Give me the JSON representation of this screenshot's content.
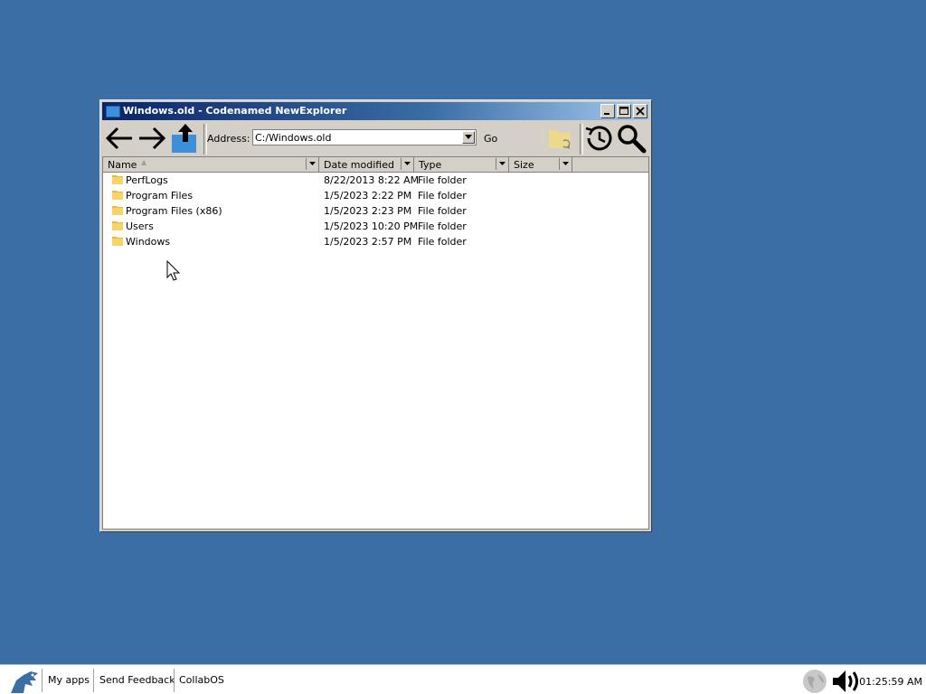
{
  "window": {
    "title": "Windows.old - Codenamed NewExplorer",
    "controls": [
      "minimize",
      "maximize",
      "close"
    ]
  },
  "toolbar": {
    "address_label": "Address:",
    "address_value": "C:/Windows.old",
    "go_label": "Go",
    "icons": [
      "back-arrow-icon",
      "forward-arrow-icon",
      "up-folder-icon",
      "sync-folder-icon",
      "history-icon",
      "search-icon"
    ]
  },
  "columns": {
    "name": "Name",
    "date": "Date modified",
    "type": "Type",
    "size": "Size"
  },
  "files": [
    {
      "name": "PerfLogs",
      "date": "8/22/2013 8:22 AM",
      "type": "File folder"
    },
    {
      "name": "Program Files",
      "date": "1/5/2023 2:22 PM",
      "type": "File folder"
    },
    {
      "name": "Program Files (x86)",
      "date": "1/5/2023 2:23 PM",
      "type": "File folder"
    },
    {
      "name": "Users",
      "date": "1/5/2023 10:20 PM",
      "type": "File folder"
    },
    {
      "name": "Windows",
      "date": "1/5/2023 2:57 PM",
      "type": "File folder"
    }
  ],
  "taskbar": {
    "my_apps": "My apps",
    "send_feedback": "Send Feedback",
    "collabos": "CollabOS",
    "clock": "01:25:59 AM"
  },
  "colors": {
    "desktop": "#3a6ea5",
    "title_start": "#0a246a",
    "folder": "#f0c040"
  }
}
